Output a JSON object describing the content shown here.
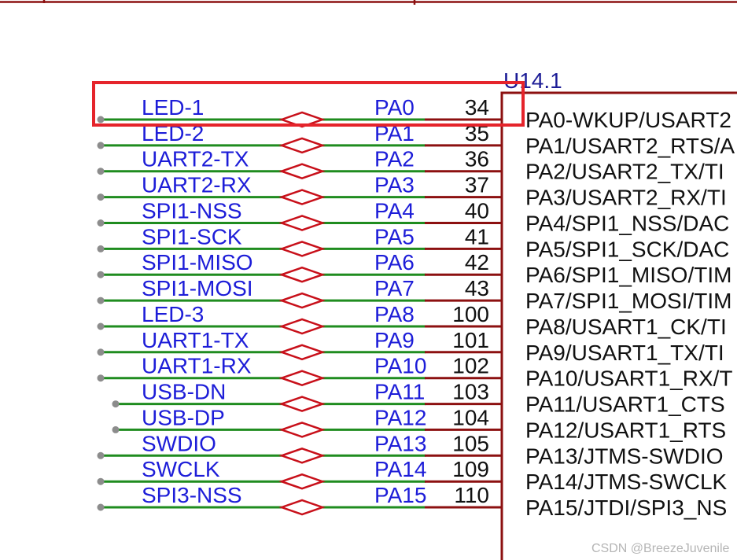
{
  "component": {
    "designator": "U14.1"
  },
  "rows": [
    {
      "net": "LED-1",
      "pin": "PA0",
      "number": "34",
      "function": "PA0-WKUP/USART2"
    },
    {
      "net": "LED-2",
      "pin": "PA1",
      "number": "35",
      "function": "PA1/USART2_RTS/A"
    },
    {
      "net": "UART2-TX",
      "pin": "PA2",
      "number": "36",
      "function": "PA2/USART2_TX/TI"
    },
    {
      "net": "UART2-RX",
      "pin": "PA3",
      "number": "37",
      "function": "PA3/USART2_RX/TI"
    },
    {
      "net": "SPI1-NSS",
      "pin": "PA4",
      "number": "40",
      "function": "PA4/SPI1_NSS/DAC"
    },
    {
      "net": "SPI1-SCK",
      "pin": "PA5",
      "number": "41",
      "function": "PA5/SPI1_SCK/DAC"
    },
    {
      "net": "SPI1-MISO",
      "pin": "PA6",
      "number": "42",
      "function": "PA6/SPI1_MISO/TIM"
    },
    {
      "net": "SPI1-MOSI",
      "pin": "PA7",
      "number": "43",
      "function": "PA7/SPI1_MOSI/TIM"
    },
    {
      "net": "LED-3",
      "pin": "PA8",
      "number": "100",
      "function": "PA8/USART1_CK/TI"
    },
    {
      "net": "UART1-TX",
      "pin": "PA9",
      "number": "101",
      "function": "PA9/USART1_TX/TI"
    },
    {
      "net": "UART1-RX",
      "pin": "PA10",
      "number": "102",
      "function": "PA10/USART1_RX/T"
    },
    {
      "net": "USB-DN",
      "pin": "PA11",
      "number": "103",
      "function": "PA11/USART1_CTS"
    },
    {
      "net": "USB-DP",
      "pin": "PA12",
      "number": "104",
      "function": "PA12/USART1_RTS"
    },
    {
      "net": "SWDIO",
      "pin": "PA13",
      "number": "105",
      "function": "PA13/JTMS-SWDIO"
    },
    {
      "net": "SWCLK",
      "pin": "PA14",
      "number": "109",
      "function": "PA14/JTMS-SWCLK"
    },
    {
      "net": "SPI3-NSS",
      "pin": "PA15",
      "number": "110",
      "function": "PA15/JTDI/SPI3_NS"
    }
  ],
  "watermark": "CSDN @BreezeJuvenile",
  "colors": {
    "net_label": "#1d1dd8",
    "designator": "#1c1c96",
    "text": "#111111",
    "wire": "#1f8c1f",
    "wire_end_dot": "#8c8c8c",
    "pin_line": "#8c1010",
    "port_outline": "#c8101a",
    "highlight": "#e5242b",
    "watermark": "#b5b5b5"
  }
}
